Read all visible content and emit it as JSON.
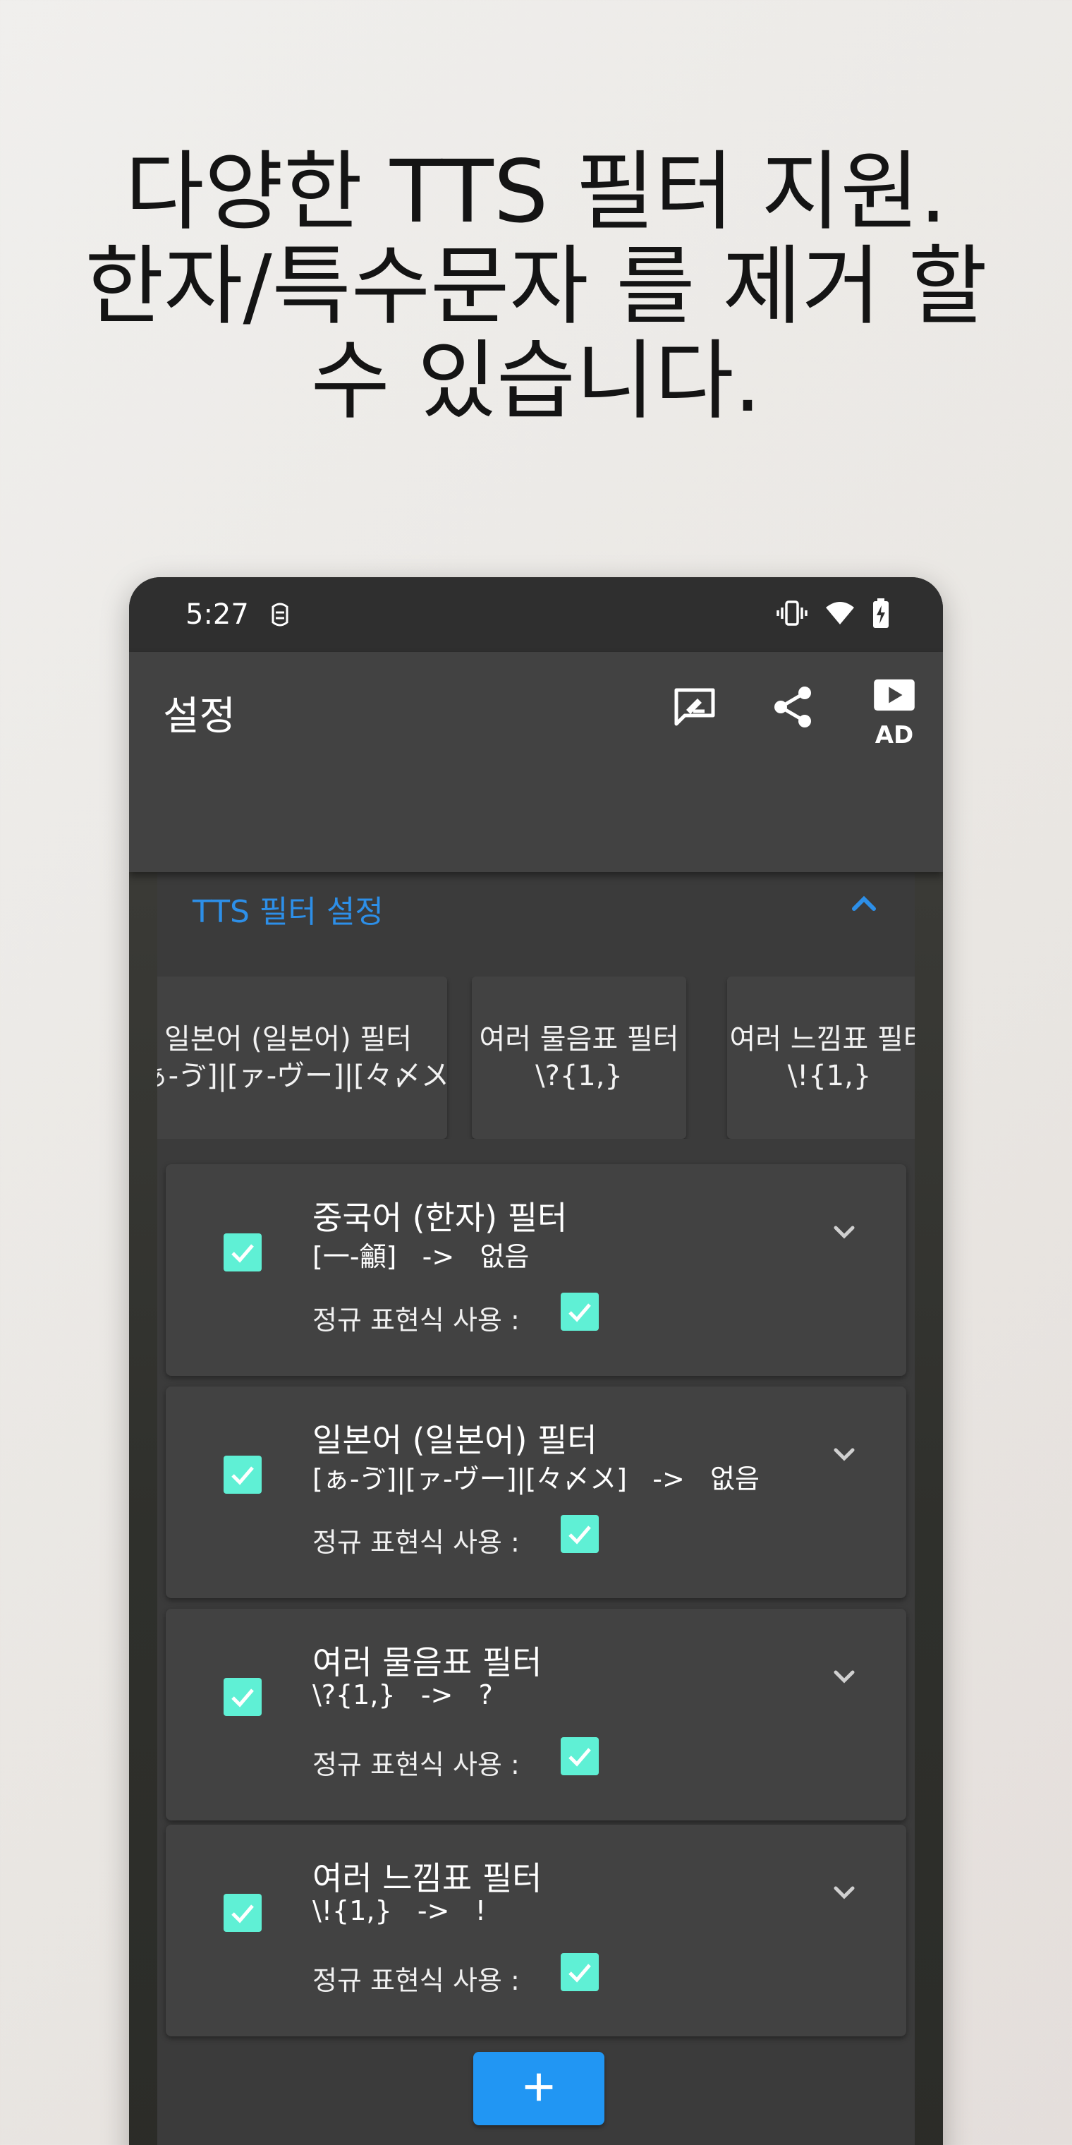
{
  "headline": {
    "line1": "다양한 TTS 필터 지원.",
    "line2": "한자/특수문자 를 제거 할",
    "line3": "수 있습니다."
  },
  "status_bar": {
    "time": "5:27",
    "icons": [
      "notification-badge-icon",
      "vibrate-icon",
      "wifi-icon",
      "battery-charging-icon"
    ]
  },
  "app_bar": {
    "title": "설정",
    "actions": [
      "feedback-icon",
      "share-icon",
      "play-ad-icon"
    ],
    "ad_label": "AD"
  },
  "section": {
    "title": "TTS 필터 설정",
    "accent_color": "#2d8fe8"
  },
  "chips": [
    {
      "name": "일본어 (일본어) 필터",
      "pattern": "[ぁ-ゔ]|[ァ-ヴー]|[々〆〤]"
    },
    {
      "name": "여러 물음표 필터",
      "pattern": "\\?{1,}"
    },
    {
      "name": "여러 느낌표 필터",
      "pattern": "\\!{1,}"
    }
  ],
  "filters": [
    {
      "name": "중국어 (한자) 필터",
      "pattern": "[一-龥]",
      "arrow": "->",
      "replacement": "없음",
      "enabled": true,
      "regex_label": "정규 표현식 사용 :",
      "regex_enabled": true
    },
    {
      "name": "일본어 (일본어) 필터",
      "pattern": "[ぁ-ゔ]|[ァ-ヴー]|[々〆〤]",
      "arrow": "->",
      "replacement": "없음",
      "enabled": true,
      "regex_label": "정규 표현식 사용 :",
      "regex_enabled": true
    },
    {
      "name": "여러 물음표 필터",
      "pattern": "\\?{1,}",
      "arrow": "->",
      "replacement": "?",
      "enabled": true,
      "regex_label": "정규 표현식 사용 :",
      "regex_enabled": true
    },
    {
      "name": "여러 느낌표 필터",
      "pattern": "\\!{1,}",
      "arrow": "->",
      "replacement": "!",
      "enabled": true,
      "regex_label": "정규 표현식 사용 :",
      "regex_enabled": true
    }
  ],
  "add_button": {
    "icon": "plus-icon",
    "color": "#2196f3"
  },
  "colors": {
    "checkbox": "#5ff0d5",
    "app_bar": "#424242",
    "status_bar": "#2f2f2f"
  }
}
